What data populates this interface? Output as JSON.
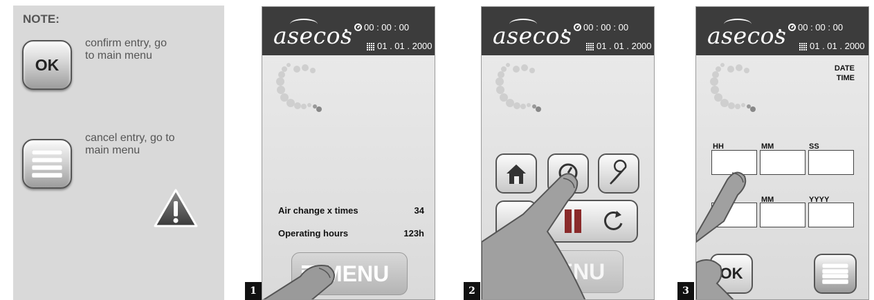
{
  "note": {
    "title": "NOTE:",
    "ok_key_label": "OK",
    "ok_description": [
      "confirm entry, go",
      "to main menu"
    ],
    "cancel_description": [
      "cancel entry, go to",
      "main menu"
    ]
  },
  "device": {
    "brand": "asecos",
    "time": "00 : 00 : 00",
    "date": "01 . 01 . 2000"
  },
  "screen1": {
    "step": "1",
    "rows": [
      {
        "label": "Air change x times",
        "value": "34"
      },
      {
        "label": "Operating hours",
        "value": "123h"
      }
    ],
    "menu_label": "MENU"
  },
  "screen2": {
    "step": "2",
    "menu_label": "MENU"
  },
  "screen3": {
    "step": "3",
    "header": [
      "DATE",
      "TIME"
    ],
    "time_labels": [
      "HH",
      "MM",
      "SS"
    ],
    "date_labels": [
      "MM",
      "YYYY"
    ],
    "ok_label": "OK"
  },
  "colors": {
    "topbar": "#3c3c3c",
    "panel": "#d9d9d9",
    "screen": "#e4e4e4"
  },
  "icons": [
    "clock-icon",
    "calendar-icon",
    "home-icon",
    "timer-icon",
    "wrench-icon",
    "refresh-icon",
    "warning-icon",
    "menu-lines-icon"
  ]
}
